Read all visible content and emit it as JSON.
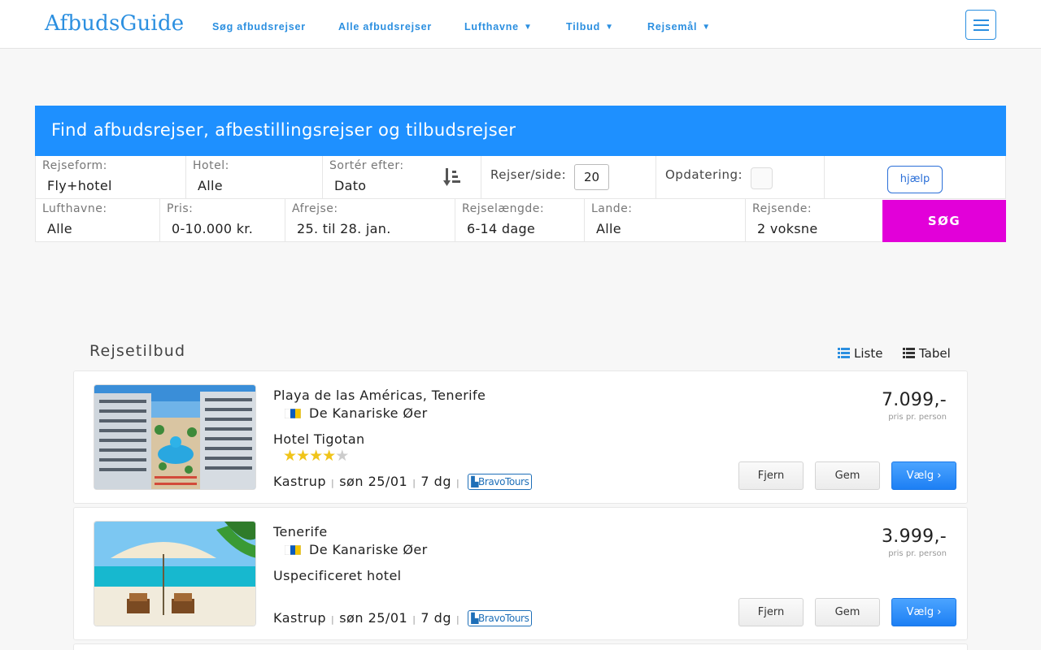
{
  "nav": {
    "brand": "AfbudsGuide",
    "links": [
      {
        "label": "Søg afbudsrejser",
        "dropdown": false
      },
      {
        "label": "Alle afbudsrejser",
        "dropdown": false
      },
      {
        "label": "Lufthavne",
        "dropdown": true
      },
      {
        "label": "Tilbud",
        "dropdown": true
      },
      {
        "label": "Rejsemål",
        "dropdown": true
      }
    ],
    "caret": "▼"
  },
  "search": {
    "title": "Find afbudsrejser, afbestillingsrejser og tilbudsrejser",
    "rejseform": {
      "label": "Rejseform:",
      "value": "Fly+hotel"
    },
    "hotel": {
      "label": "Hotel:",
      "value": "Alle"
    },
    "sort": {
      "label": "Sortér efter:",
      "value": "Dato"
    },
    "perpage": {
      "label": "Rejser/side:",
      "value": "20"
    },
    "update": {
      "label": "Opdatering:"
    },
    "help_label": "hjælp",
    "airports": {
      "label": "Lufthavne:",
      "value": "Alle"
    },
    "price": {
      "label": "Pris:",
      "value": "0-10.000 kr."
    },
    "departure": {
      "label": "Afrejse:",
      "value": "25. til 28. jan."
    },
    "length": {
      "label": "Rejselængde:",
      "value": "6-14 dage"
    },
    "countries": {
      "label": "Lande:",
      "value": "Alle"
    },
    "travelers": {
      "label": "Rejsende:",
      "value": "2 voksne"
    },
    "search_label": "SØG"
  },
  "results": {
    "title": "Rejsetilbud",
    "view_list": "Liste",
    "view_table": "Tabel",
    "items": [
      {
        "destination": "Playa de las Américas, Tenerife",
        "region": "De Kanariske Øer",
        "hotel": "Hotel Tigotan",
        "stars": 4,
        "airport": "Kastrup",
        "date": "søn 25/01",
        "duration": "7 dg",
        "operator": "BravoTours",
        "price": "7.099,-",
        "price_note": "pris pr. person",
        "btn_remove": "Fjern",
        "btn_save": "Gem",
        "btn_select": "Vælg ›"
      },
      {
        "destination": "Tenerife",
        "region": "De Kanariske Øer",
        "hotel": "Uspecificeret hotel",
        "airport": "Kastrup",
        "date": "søn 25/01",
        "duration": "7 dg",
        "operator": "BravoTours",
        "price": "3.999,-",
        "price_note": "pris pr. person",
        "btn_remove": "Fjern",
        "btn_save": "Gem",
        "btn_select": "Vælg ›"
      }
    ]
  },
  "colors": {
    "brand": "#2b8fe0",
    "header_blue": "#1e90ff",
    "search_magenta": "#e200d9",
    "primary_button": "#1d7ff4",
    "star": "#f0c419"
  }
}
